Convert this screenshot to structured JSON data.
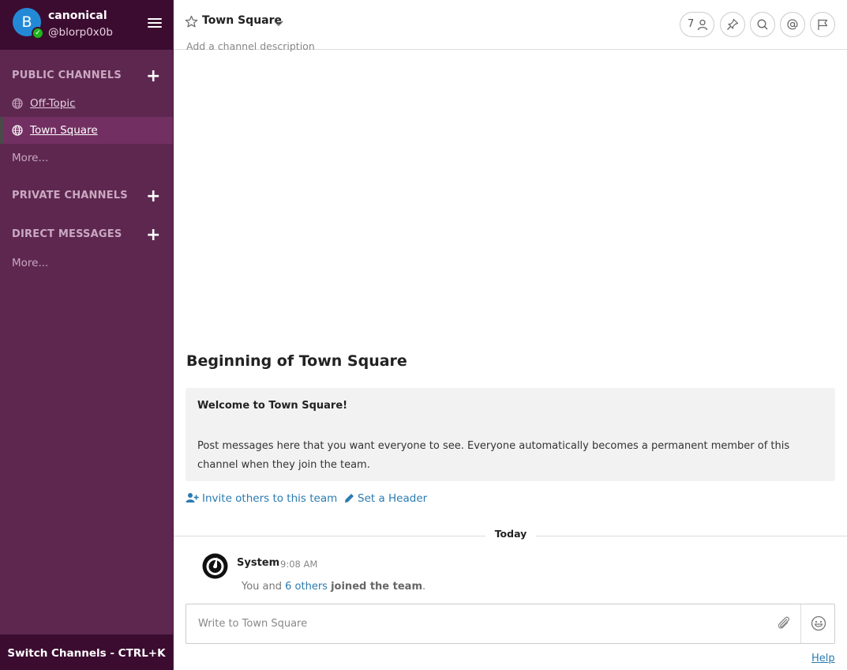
{
  "sidebar": {
    "team_name": "canonical",
    "avatar_letter": "B",
    "username": "@blorp0x0b",
    "public_channels_title": "PUBLIC CHANNELS",
    "public_channels": [
      {
        "label": "Off-Topic",
        "active": false
      },
      {
        "label": "Town Square",
        "active": true
      }
    ],
    "public_more": "More...",
    "private_channels_title": "PRIVATE CHANNELS",
    "direct_messages_title": "DIRECT MESSAGES",
    "dm_more": "More...",
    "switch_channels": "Switch Channels - CTRL+K"
  },
  "header": {
    "channel_title": "Town Square",
    "description_placeholder": "Add a channel description",
    "member_count": "7"
  },
  "intro": {
    "title": "Beginning of Town Square",
    "welcome": "Welcome to Town Square!",
    "body": "Post messages here that you want everyone to see. Everyone automatically becomes a permanent member of this channel when they join the team.",
    "invite_link": "Invite others to this team",
    "set_header_link": "Set a Header"
  },
  "date_separator": "Today",
  "post": {
    "author": "System",
    "time": "9:08 AM",
    "msg_prefix": "You and ",
    "msg_link": "6 others",
    "msg_suffix": "joined the team",
    "msg_end": "."
  },
  "composer": {
    "placeholder": "Write to Town Square"
  },
  "help_link": "Help",
  "colors": {
    "sidebar_bg": "#5e2750",
    "sidebar_header_bg": "#3b0c30",
    "link": "#2a7bb0",
    "online": "#1db61c"
  }
}
